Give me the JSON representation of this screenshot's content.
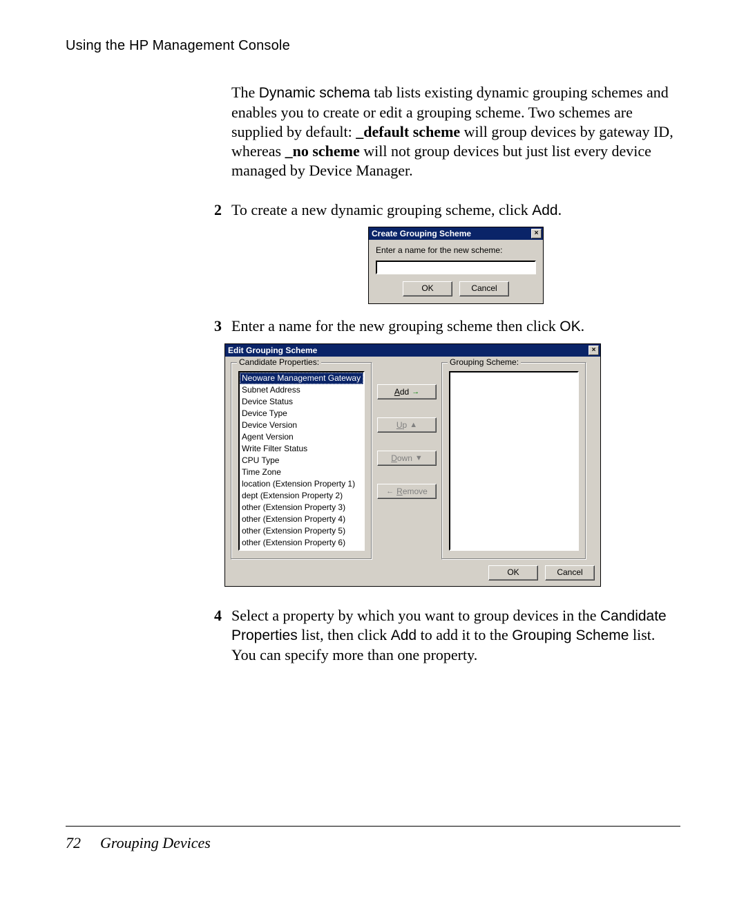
{
  "header": {
    "running_head": "Using the HP Management Console"
  },
  "intro": {
    "pre": "The ",
    "tab_label": "Dynamic schema",
    "mid1": " tab lists existing dynamic grouping schemes and enables you to create or edit a grouping scheme. Two schemes are supplied by default: ",
    "bold1": "_default scheme",
    "mid2": " will group devices by gateway ID, whereas ",
    "bold2": "_no scheme",
    "mid3": " will not group devices but just list every device managed by Device Manager."
  },
  "steps": {
    "s2": {
      "num": "2",
      "pre": "To create a new dynamic grouping scheme, click ",
      "code": "Add",
      "post": "."
    },
    "s3": {
      "num": "3",
      "pre": "Enter a name for the new grouping scheme then click ",
      "code": "OK",
      "post": "."
    },
    "s4": {
      "num": "4",
      "p1_pre": "Select a property by which you want to group devices in the ",
      "p1_code1": "Candidate Properties",
      "p1_mid": " list, then click ",
      "p1_code2": "Add",
      "p1_mid2": " to add it to the ",
      "p1_code3": "Grouping Scheme",
      "p1_post": " list. You can specify more than one property."
    }
  },
  "create_dialog": {
    "title": "Create Grouping Scheme",
    "close_glyph": "×",
    "label": "Enter a name for the new scheme:",
    "input_value": "",
    "ok": "OK",
    "cancel": "Cancel"
  },
  "edit_dialog": {
    "title": "Edit Grouping Scheme",
    "close_glyph": "×",
    "legend_left": "Candidate Properties:",
    "legend_right": "Grouping Scheme:",
    "items": [
      "Neoware Management Gateway ID",
      "Subnet Address",
      "Device Status",
      "Device Type",
      "Device Version",
      "Agent Version",
      "Write Filter Status",
      "CPU Type",
      "Time Zone",
      "location (Extension Property 1)",
      "dept (Extension Property 2)",
      "other (Extension Property 3)",
      "other (Extension Property 4)",
      "other (Extension Property 5)",
      "other (Extension Property 6)"
    ],
    "selected_index": 0,
    "btn_add_u": "A",
    "btn_add_rest": "dd",
    "btn_up_u": "U",
    "btn_up_rest": "p",
    "btn_down_u": "D",
    "btn_down_rest": "own",
    "btn_remove_u": "R",
    "btn_remove_rest": "emove",
    "ok": "OK",
    "cancel": "Cancel"
  },
  "footer": {
    "page_number": "72",
    "section": "Grouping Devices"
  }
}
